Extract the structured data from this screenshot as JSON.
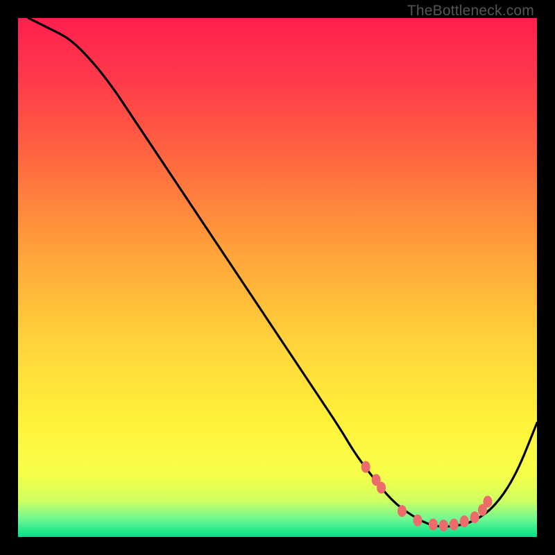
{
  "watermark": "TheBottleneck.com",
  "chart_data": {
    "type": "line",
    "title": "",
    "xlabel": "",
    "ylabel": "",
    "xlim": [
      0,
      100
    ],
    "ylim": [
      0,
      100
    ],
    "gradient_stops": [
      {
        "offset": 0.0,
        "color": "#ff1f4e"
      },
      {
        "offset": 0.12,
        "color": "#ff3a4b"
      },
      {
        "offset": 0.28,
        "color": "#ff6a3f"
      },
      {
        "offset": 0.45,
        "color": "#ffa23a"
      },
      {
        "offset": 0.62,
        "color": "#ffd23a"
      },
      {
        "offset": 0.78,
        "color": "#fff23a"
      },
      {
        "offset": 0.88,
        "color": "#f7ff4a"
      },
      {
        "offset": 0.93,
        "color": "#d0ff60"
      },
      {
        "offset": 0.965,
        "color": "#70f890"
      },
      {
        "offset": 1.0,
        "color": "#00e08a"
      }
    ],
    "series": [
      {
        "name": "bottleneck-curve",
        "x": [
          2,
          6,
          10,
          14,
          18,
          22,
          26,
          30,
          34,
          38,
          42,
          46,
          50,
          54,
          58,
          62,
          65,
          68,
          72,
          76,
          80,
          84,
          88,
          92,
          96,
          100
        ],
        "y": [
          100,
          98,
          96,
          92,
          87,
          81,
          75,
          69,
          63,
          57,
          51,
          45,
          39,
          33,
          27,
          21,
          16,
          12,
          7,
          4,
          2,
          2,
          3,
          6,
          12,
          22
        ]
      }
    ],
    "markers": {
      "name": "highlight-dots",
      "color": "#ed6b6b",
      "points": [
        {
          "x": 67,
          "y": 13.5
        },
        {
          "x": 69,
          "y": 11
        },
        {
          "x": 70,
          "y": 9.5
        },
        {
          "x": 74,
          "y": 5
        },
        {
          "x": 77,
          "y": 3.2
        },
        {
          "x": 80,
          "y": 2.4
        },
        {
          "x": 82,
          "y": 2.2
        },
        {
          "x": 84,
          "y": 2.4
        },
        {
          "x": 86,
          "y": 3.0
        },
        {
          "x": 88,
          "y": 3.8
        },
        {
          "x": 89.5,
          "y": 5.2
        },
        {
          "x": 90.5,
          "y": 6.8
        }
      ]
    }
  }
}
